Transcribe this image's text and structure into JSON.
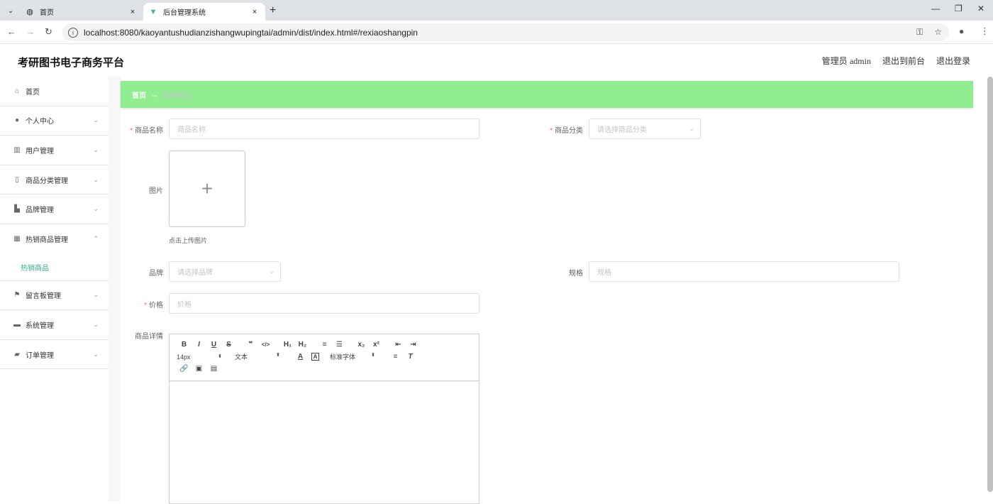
{
  "browser": {
    "tabs": [
      {
        "label": "首页",
        "icon": "globe-icon",
        "close": "×"
      },
      {
        "label": "后台管理系统",
        "icon": "vue-icon",
        "close": "×"
      }
    ],
    "new_tab": "+",
    "url": "localhost:8080/kaoyantushudianzishangwupingtai/admin/dist/index.html#/rexiaoshangpin",
    "window_controls": {
      "minimize": "—",
      "restore": "❐",
      "close": "✕"
    }
  },
  "header": {
    "title": "考研图书电子商务平台",
    "admin_label": "管理员",
    "admin_name": "admin",
    "to_front": "退出到前台",
    "logout": "退出登录"
  },
  "sidebar": {
    "items": [
      {
        "label": "首页",
        "icon": "home-icon",
        "chevron": ""
      },
      {
        "label": "个人中心",
        "icon": "user-icon",
        "chevron": "⌄"
      },
      {
        "label": "用户管理",
        "icon": "users-icon",
        "chevron": "⌄"
      },
      {
        "label": "商品分类管理",
        "icon": "category-icon",
        "chevron": "⌄"
      },
      {
        "label": "品牌管理",
        "icon": "brand-icon",
        "chevron": "⌄"
      },
      {
        "label": "热销商品管理",
        "icon": "grid-icon",
        "chevron": "⌃"
      },
      {
        "label": "留言板管理",
        "icon": "flag-icon",
        "chevron": "⌄"
      },
      {
        "label": "系统管理",
        "icon": "system-icon",
        "chevron": "⌄"
      },
      {
        "label": "订单管理",
        "icon": "order-icon",
        "chevron": "⌄"
      }
    ],
    "active_sub": "热销商品"
  },
  "breadcrumb": {
    "home": "首页",
    "arrow": "→",
    "current": "热销商品"
  },
  "form": {
    "name": {
      "label": "商品名称",
      "placeholder": "商品名称",
      "required": true
    },
    "category": {
      "label": "商品分类",
      "placeholder": "请选择商品分类",
      "required": true
    },
    "image": {
      "label": "图片",
      "tip": "点击上传图片",
      "plus": "+"
    },
    "brand": {
      "label": "品牌",
      "placeholder": "请选择品牌"
    },
    "spec": {
      "label": "规格",
      "placeholder": "规格"
    },
    "price": {
      "label": "价格",
      "placeholder": "价格",
      "required": true
    },
    "detail": {
      "label": "商品详情"
    }
  },
  "editor_toolbar": {
    "row1": [
      "B",
      "I",
      "U",
      "S",
      "❞",
      "</>",
      "H₁",
      "H₂",
      "≡",
      "☰",
      "x₂",
      "x²",
      "⇤",
      "⇥"
    ],
    "size": "14px",
    "header": "文本",
    "font": "标准字体",
    "row3": [
      "🔗",
      "▣",
      "▤"
    ]
  }
}
